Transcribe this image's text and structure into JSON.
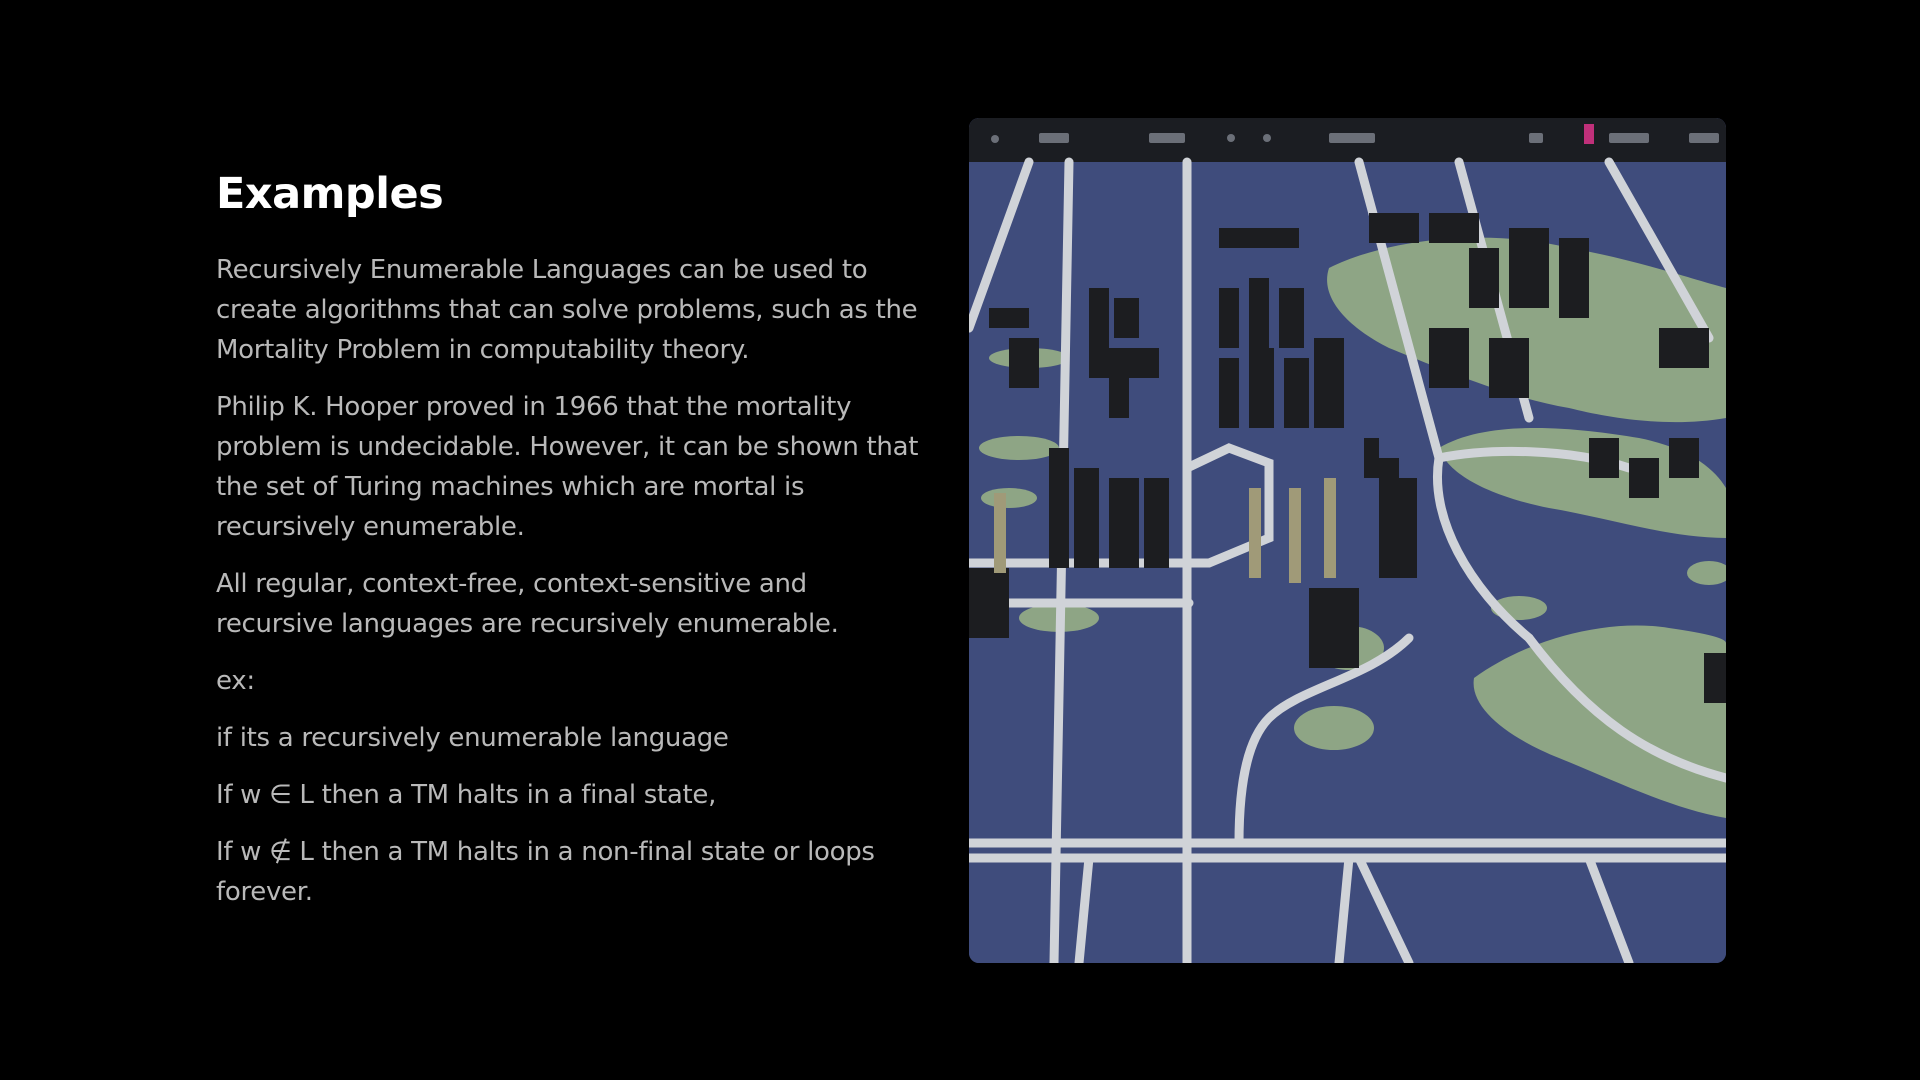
{
  "slide": {
    "title": "Examples",
    "paragraphs": [
      "Recursively Enumerable Languages can be used to create algorithms that can solve problems, such as the Mortality Problem in computability theory.",
      "Philip K. Hooper proved in 1966 that the mortality problem is undecidable. However, it can be shown that the set of Turing machines which are mortal is recursively enumerable.",
      "All regular, context-free, context-sensitive and recursive languages are recursively enumerable.",
      "ex:",
      "if its a recursively enumerable language",
      "If w ∈ L then a TM halts in a final state,",
      "If w ∉ L then a TM halts in a non-final state or loops forever."
    ]
  },
  "image": {
    "kind": "3D city map illustration",
    "colors": {
      "water": "#3f4c7c",
      "land": "#8ea585",
      "road": "#d0d3d8",
      "building": "#1c1d20",
      "toolbar": "#1b1d22"
    }
  }
}
